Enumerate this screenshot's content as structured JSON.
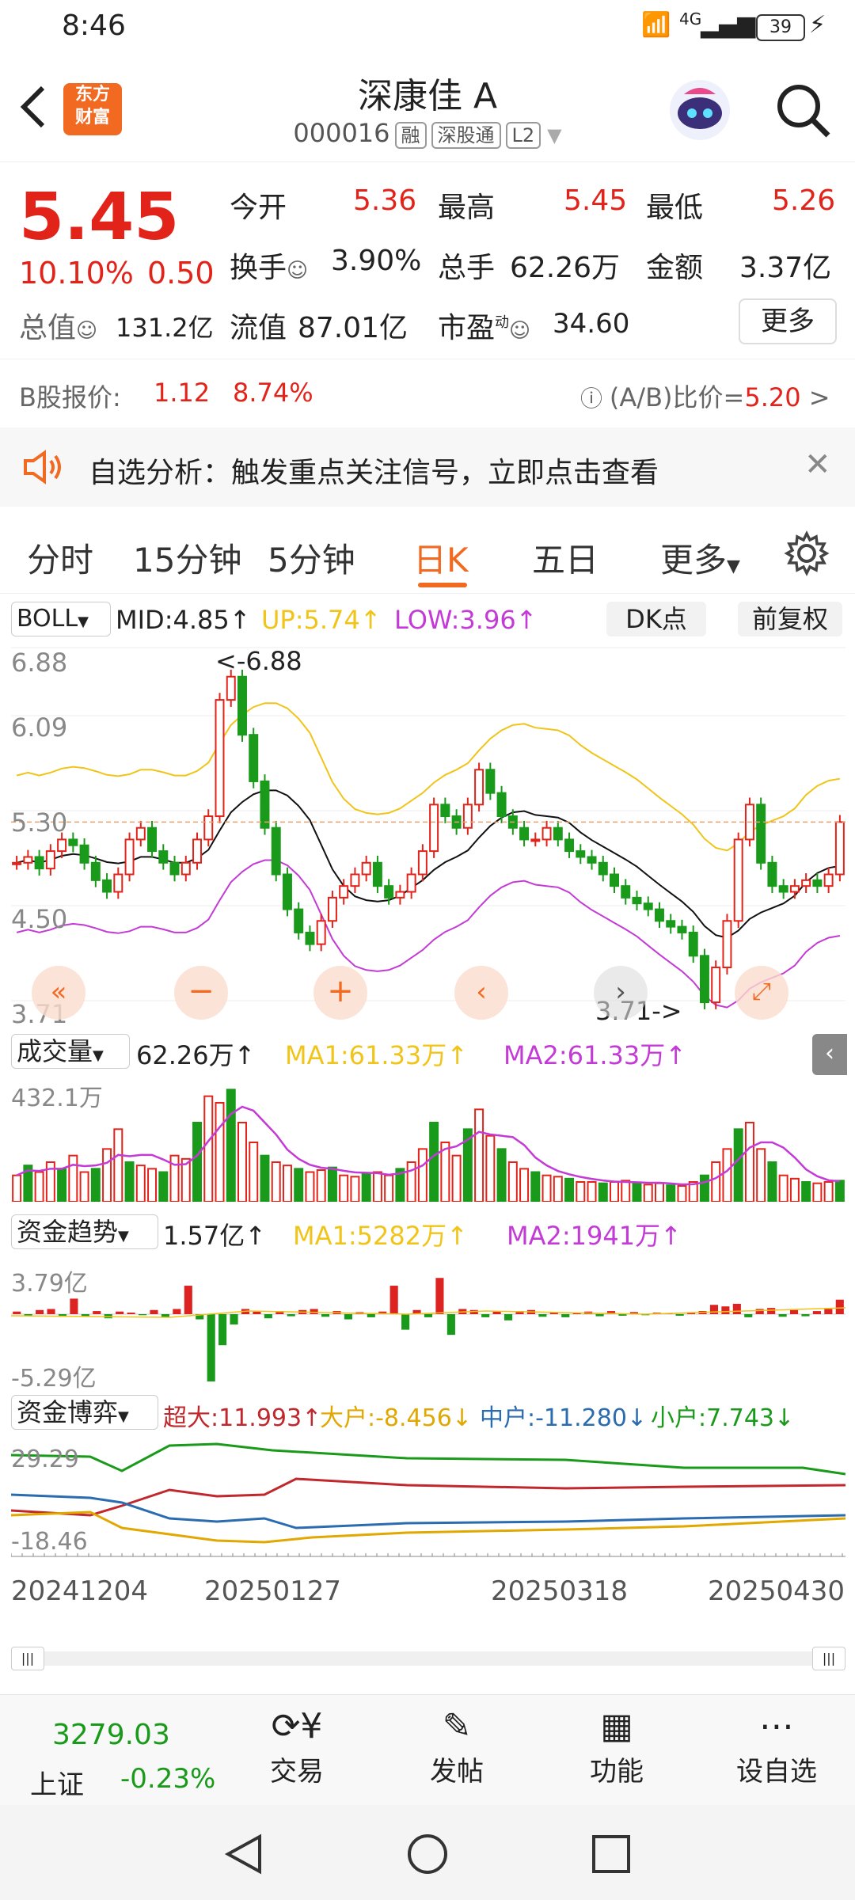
{
  "status": {
    "time": "8:46",
    "network": "4G",
    "battery": "39"
  },
  "header": {
    "title": "深康佳 A",
    "code": "000016",
    "tags": [
      "融",
      "深股通",
      "L2"
    ],
    "logo_line1": "东方",
    "logo_line2": "财富"
  },
  "quote": {
    "price": "5.45",
    "pct": "10.10%",
    "chg": "0.50",
    "open_label": "今开",
    "open": "5.36",
    "high_label": "最高",
    "high": "5.45",
    "low_label": "最低",
    "low": "5.26",
    "turnover_label": "换手",
    "turnover": "3.90%",
    "vol_label": "总手",
    "vol": "62.26万",
    "amount_label": "金额",
    "amount": "3.37亿",
    "mktcap_label": "总值",
    "mktcap": "131.2亿",
    "float_label": "流值",
    "float": "87.01亿",
    "pe_label": "市盈",
    "pe_sup": "动",
    "pe": "34.60",
    "more": "更多",
    "b_label": "B股报价:",
    "b_price": "1.12",
    "b_pct": "8.74%",
    "ab_label": "(A/B)比价=",
    "ab_value": "5.20"
  },
  "banner": {
    "text": "自选分析：触发重点关注信号，立即点击查看"
  },
  "tabs": [
    "分时",
    "15分钟",
    "5分钟",
    "日K",
    "五日",
    "更多"
  ],
  "active_tab": "日K",
  "boll": {
    "name": "BOLL",
    "mid": "MID:4.85↑",
    "up": "UP:5.74↑",
    "low": "LOW:3.96↑",
    "dk": "DK点",
    "fq": "前复权"
  },
  "price_axis": {
    "top": "6.88",
    "mid1": "6.09",
    "mid2": "5.30",
    "mid3": "4.50",
    "bottom": "3.71"
  },
  "annotations": {
    "high": "<-6.88",
    "low": "3.71->"
  },
  "volume": {
    "name": "成交量",
    "value": "62.26万↑",
    "ma1": "MA1:61.33万↑",
    "ma2": "MA2:61.33万↑",
    "axis_top": "432.1万"
  },
  "fund": {
    "name": "资金趋势",
    "value": "1.57亿↑",
    "ma1": "MA1:5282万↑",
    "ma2": "MA2:1941万↑",
    "axis_top": "3.79亿",
    "axis_bottom": "-5.29亿"
  },
  "game": {
    "name": "资金博弈",
    "super": "超大:11.993↑",
    "big": "大户:-8.456↓",
    "mid": "中户:-11.280↓",
    "small": "小户:7.743↓",
    "axis_top": "29.29",
    "axis_bottom": "-18.46"
  },
  "dates": [
    "20241204",
    "20250127",
    "20250318",
    "20250430"
  ],
  "bottomnav": {
    "index_value": "3279.03",
    "index_name": "上证",
    "index_pct": "-0.23%",
    "trade": "交易",
    "post": "发帖",
    "func": "功能",
    "watch": "设自选"
  },
  "colors": {
    "up": "#e2231a",
    "down": "#1a9a1a",
    "accent": "#f26a21",
    "up_band": "#f0c419",
    "low_band": "#c43ad6"
  }
}
